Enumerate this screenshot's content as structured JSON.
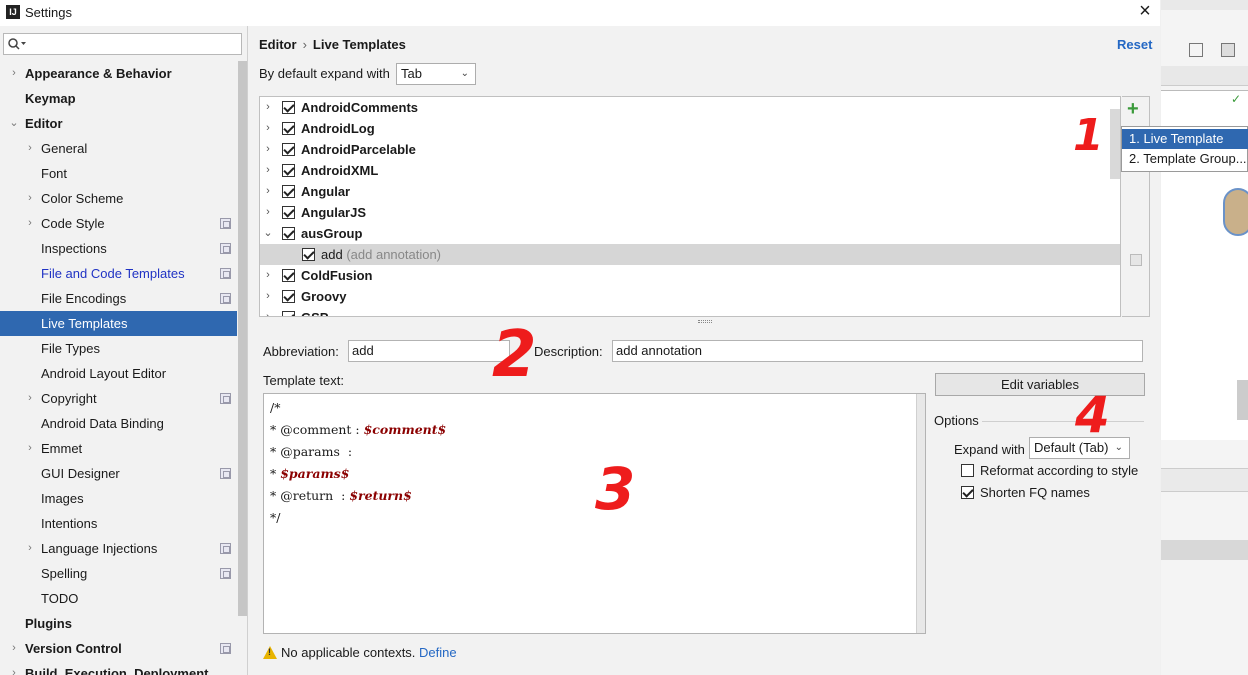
{
  "window": {
    "title": "Settings",
    "close_glyph": "×"
  },
  "search": {
    "placeholder": ""
  },
  "sidebar": {
    "items": [
      {
        "label": "Appearance & Behavior",
        "level": 0,
        "bold": true,
        "arrow": "›"
      },
      {
        "label": "Keymap",
        "level": 0,
        "bold": true
      },
      {
        "label": "Editor",
        "level": 0,
        "bold": true,
        "arrow": "⌄"
      },
      {
        "label": "General",
        "level": 1,
        "arrow": "›"
      },
      {
        "label": "Font",
        "level": 1
      },
      {
        "label": "Color Scheme",
        "level": 1,
        "arrow": "›"
      },
      {
        "label": "Code Style",
        "level": 1,
        "arrow": "›",
        "icon": true
      },
      {
        "label": "Inspections",
        "level": 1,
        "icon": true
      },
      {
        "label": "File and Code Templates",
        "level": 1,
        "icon": true,
        "blue": true
      },
      {
        "label": "File Encodings",
        "level": 1,
        "icon": true
      },
      {
        "label": "Live Templates",
        "level": 1,
        "selected": true
      },
      {
        "label": "File Types",
        "level": 1
      },
      {
        "label": "Android Layout Editor",
        "level": 1
      },
      {
        "label": "Copyright",
        "level": 1,
        "arrow": "›",
        "icon": true
      },
      {
        "label": "Android Data Binding",
        "level": 1
      },
      {
        "label": "Emmet",
        "level": 1,
        "arrow": "›"
      },
      {
        "label": "GUI Designer",
        "level": 1,
        "icon": true
      },
      {
        "label": "Images",
        "level": 1
      },
      {
        "label": "Intentions",
        "level": 1
      },
      {
        "label": "Language Injections",
        "level": 1,
        "arrow": "›",
        "icon": true
      },
      {
        "label": "Spelling",
        "level": 1,
        "icon": true
      },
      {
        "label": "TODO",
        "level": 1
      },
      {
        "label": "Plugins",
        "level": 0,
        "bold": true
      },
      {
        "label": "Version Control",
        "level": 0,
        "bold": true,
        "arrow": "›",
        "icon": true
      },
      {
        "label": "Build, Execution, Deployment",
        "level": 0,
        "bold": true,
        "arrow": "›"
      }
    ]
  },
  "header": {
    "crumb1": "Editor",
    "crumb_sep": "›",
    "crumb2": "Live Templates",
    "reset": "Reset"
  },
  "expand_default": {
    "label": "By default expand with",
    "value": "Tab"
  },
  "templates": [
    {
      "label": "AndroidComments",
      "expanded": false
    },
    {
      "label": "AndroidLog",
      "expanded": false
    },
    {
      "label": "AndroidParcelable",
      "expanded": false
    },
    {
      "label": "AndroidXML",
      "expanded": false
    },
    {
      "label": "Angular",
      "expanded": false
    },
    {
      "label": "AngularJS",
      "expanded": false
    },
    {
      "label": "ausGroup",
      "expanded": true
    },
    {
      "label": "add",
      "desc": "(add annotation)",
      "child": true,
      "selected": true
    },
    {
      "label": "ColdFusion",
      "expanded": false
    },
    {
      "label": "Groovy",
      "expanded": false
    },
    {
      "label": "GSP",
      "expanded": false
    }
  ],
  "toolbar": {
    "add_glyph": "+"
  },
  "popup": {
    "items": [
      "1. Live Template",
      "2. Template Group..."
    ]
  },
  "abbreviation": {
    "label": "Abbreviation:",
    "value": "add"
  },
  "description": {
    "label": "Description:",
    "value": "add annotation"
  },
  "template_text": {
    "label": "Template text:",
    "lines": [
      [
        {
          "t": "/*"
        }
      ],
      [
        {
          "t": "* @comment : "
        },
        {
          "t": "$comment$",
          "var": true
        }
      ],
      [
        {
          "t": "* @params  :"
        }
      ],
      [
        {
          "t": "* "
        },
        {
          "t": "$params$",
          "var": true
        }
      ],
      [
        {
          "t": "* @return  : "
        },
        {
          "t": "$return$",
          "var": true
        }
      ],
      [
        {
          "t": "*/"
        }
      ]
    ]
  },
  "edit_variables": "Edit variables",
  "options": {
    "label": "Options",
    "expand_label": "Expand with",
    "expand_value": "Default (Tab)",
    "reformat": {
      "label": "Reformat according to style",
      "checked": false
    },
    "shorten": {
      "label": "Shorten FQ names",
      "checked": true
    }
  },
  "footer": {
    "warning": "No applicable contexts.",
    "link": "Define"
  },
  "annotations": [
    "1",
    "2",
    "3",
    "4"
  ]
}
